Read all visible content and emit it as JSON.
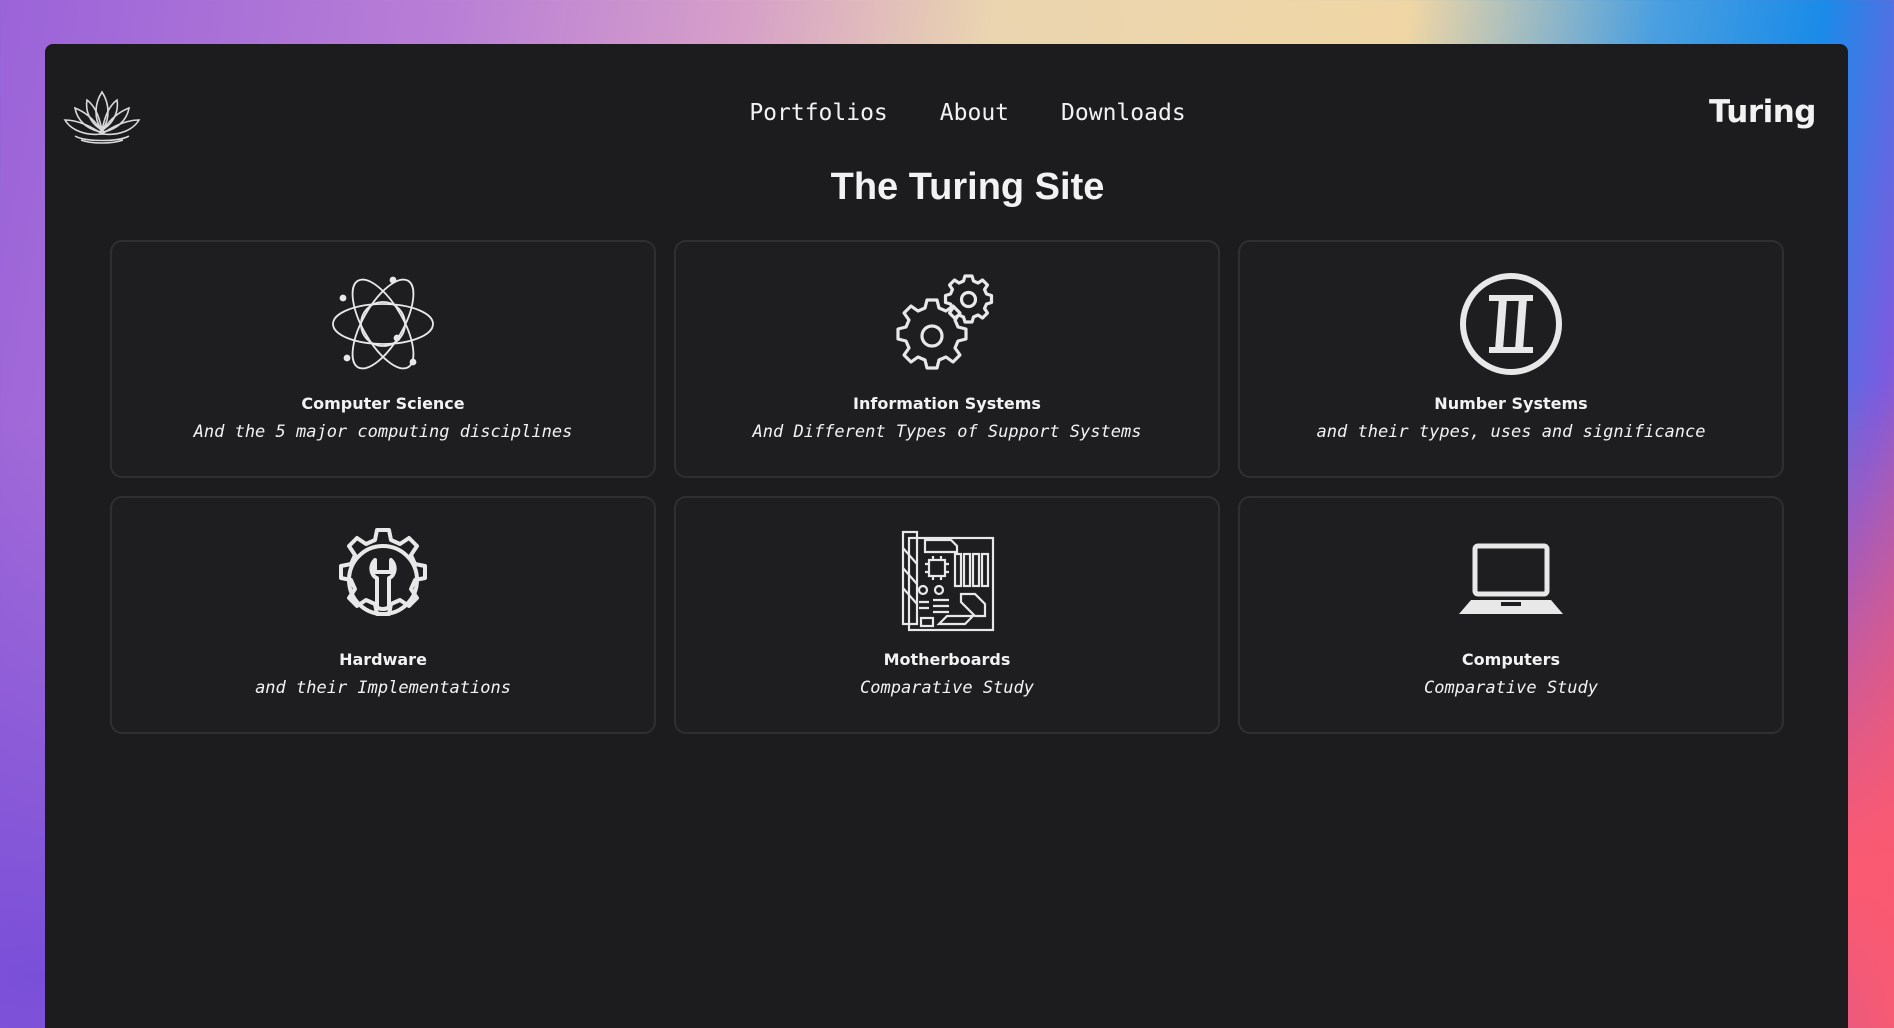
{
  "nav": {
    "items": [
      {
        "label": "Portfolios"
      },
      {
        "label": "About"
      },
      {
        "label": "Downloads"
      }
    ],
    "brand": "Turing",
    "logo_icon": "lotus-icon"
  },
  "page": {
    "title": "The Turing Site"
  },
  "cards": [
    {
      "title": "Computer Science",
      "subtitle": "And the 5 major computing disciplines",
      "icon": "atom-icon"
    },
    {
      "title": "Information Systems",
      "subtitle": "And Different Types of Support Systems",
      "icon": "gears-icon"
    },
    {
      "title": "Number Systems",
      "subtitle": "and their types, uses and significance",
      "icon": "roman-numeral-two-icon"
    },
    {
      "title": "Hardware",
      "subtitle": "and their Implementations",
      "icon": "gear-wrench-icon"
    },
    {
      "title": "Motherboards",
      "subtitle": "Comparative Study",
      "icon": "motherboard-icon"
    },
    {
      "title": "Computers",
      "subtitle": "Comparative Study",
      "icon": "laptop-icon"
    }
  ],
  "colors": {
    "window_bg": "#1c1c1e",
    "card_border": "#2f2f33",
    "text": "#f2f2f2"
  }
}
